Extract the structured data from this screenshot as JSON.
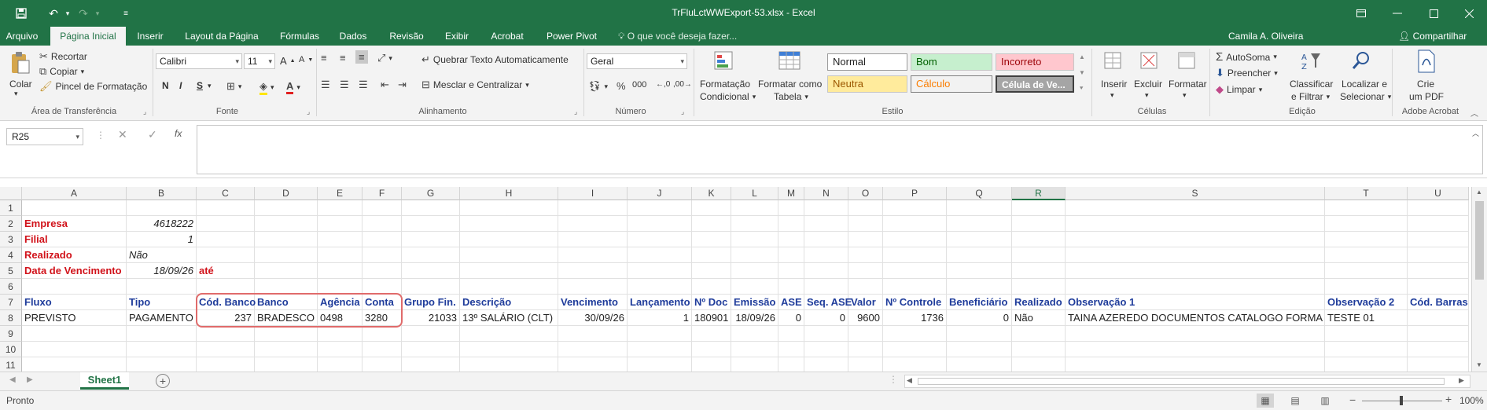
{
  "title_bar": {
    "document_title": "TrFluLctWWExport-53.xlsx - Excel",
    "quick_access": [
      "save-icon",
      "undo-icon",
      "redo-icon",
      "customize-icon"
    ]
  },
  "tabs": [
    "Arquivo",
    "Página Inicial",
    "Inserir",
    "Layout da Página",
    "Fórmulas",
    "Dados",
    "Revisão",
    "Exibir",
    "Acrobat",
    "Power Pivot"
  ],
  "active_tab": "Página Inicial",
  "help_search": "O que você deseja fazer...",
  "user_name": "Camila A. Oliveira",
  "share_label": "Compartilhar",
  "ribbon": {
    "clipboard": {
      "paste": "Colar",
      "cut": "Recortar",
      "copy": "Copiar",
      "format_painter": "Pincel de Formatação",
      "label": "Área de Transferência"
    },
    "font": {
      "name": "Calibri",
      "size": "11",
      "label": "Fonte",
      "bold": "N",
      "italic": "I",
      "underline": "S"
    },
    "alignment": {
      "wrap": "Quebrar Texto Automaticamente",
      "merge": "Mesclar e Centralizar",
      "label": "Alinhamento"
    },
    "number": {
      "format": "Geral",
      "label": "Número"
    },
    "styles": {
      "conditional_1": "Formatação",
      "conditional_2": "Condicional",
      "table_1": "Formatar como",
      "table_2": "Tabela",
      "normal": "Normal",
      "good": "Bom",
      "bad": "Incorreto",
      "neutral": "Neutra",
      "calc": "Cálculo",
      "check": "Célula de Ve...",
      "label": "Estilo"
    },
    "cells": {
      "insert": "Inserir",
      "delete": "Excluir",
      "format": "Formatar",
      "label": "Células"
    },
    "editing": {
      "autosum": "AutoSoma",
      "fill": "Preencher",
      "clear": "Limpar",
      "sort_1": "Classificar",
      "sort_2": "e Filtrar",
      "find_1": "Localizar e",
      "find_2": "Selecionar",
      "label": "Edição"
    },
    "acrobat": {
      "create_1": "Crie",
      "create_2": "um PDF",
      "label": "Adobe Acrobat"
    }
  },
  "name_box": "R25",
  "columns": [
    "A",
    "B",
    "C",
    "D",
    "E",
    "F",
    "G",
    "H",
    "I",
    "J",
    "K",
    "L",
    "M",
    "N",
    "O",
    "P",
    "Q",
    "R",
    "S",
    "T",
    "U"
  ],
  "selected_column": "R",
  "rows": [
    "1",
    "2",
    "3",
    "4",
    "5",
    "6",
    "7",
    "8",
    "9",
    "10",
    "11"
  ],
  "info": {
    "empresa_label": "Empresa",
    "empresa_value": "4618222",
    "filial_label": "Filial",
    "filial_value": "1",
    "realizado_label": "Realizado",
    "realizado_value": "Não",
    "vencimento_label": "Data de Vencimento",
    "vencimento_value": "18/09/26",
    "ate": "até"
  },
  "table_headers": [
    "Fluxo",
    "Tipo",
    "Cód. Banco",
    "Banco",
    "Agência",
    "Conta",
    "Grupo Fin.",
    "Descrição",
    "Vencimento",
    "Lançamento",
    "Nº Doc",
    "Emissão",
    "ASE",
    "Seq. ASE",
    "Valor",
    "Nº Controle",
    "Beneficiário",
    "Realizado",
    "Observação 1",
    "Observação 2",
    "Cód. Barras"
  ],
  "table_row": [
    "PREVISTO",
    "PAGAMENTO",
    "237",
    "BRADESCO",
    "0498",
    "3280",
    "21033",
    "13º SALÁRIO (CLT)",
    "30/09/26",
    "1",
    "180901",
    "18/09/26",
    "0",
    "0",
    "9600",
    "1736",
    "0",
    "Não",
    "TAINA AZEREDO  DOCUMENTOS CATALOGO FORMA",
    "TESTE 01",
    ""
  ],
  "sheet_tab": "Sheet1",
  "status": "Pronto",
  "zoom": "100%"
}
